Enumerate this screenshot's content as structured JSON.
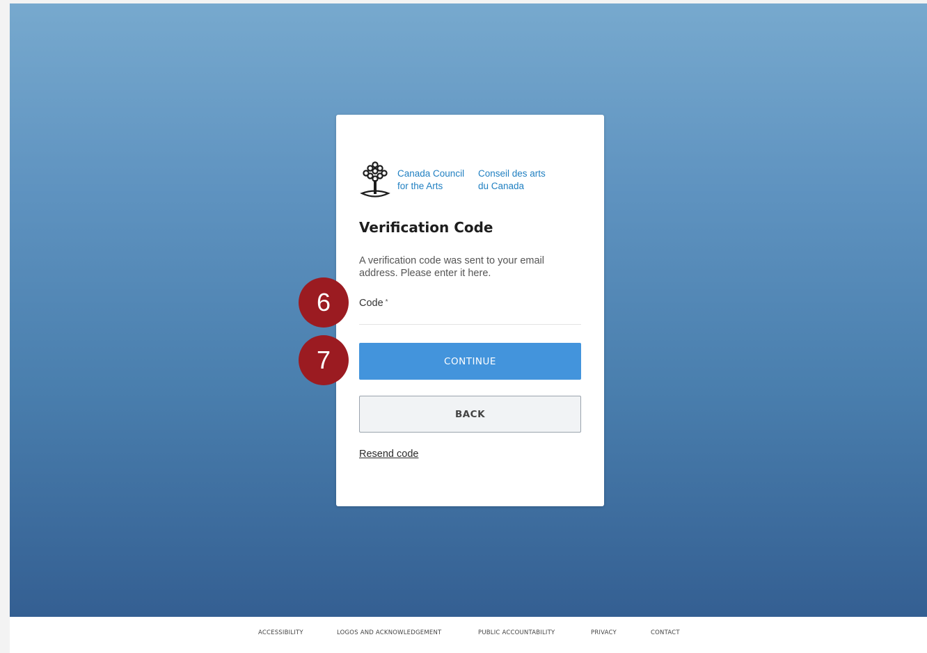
{
  "logo": {
    "en_line1": "Canada Council",
    "en_line2": "for the Arts",
    "fr_line1": "Conseil des arts",
    "fr_line2": "du Canada"
  },
  "card": {
    "title": "Verification Code",
    "description": "A verification code was sent to your email address. Please enter it here.",
    "code_label": "Code",
    "required_mark": "*",
    "code_value": "",
    "continue_label": "CONTINUE",
    "back_label": "BACK",
    "resend_label": "Resend code"
  },
  "markers": {
    "step6": "6",
    "step7": "7"
  },
  "footer": {
    "links": [
      "ACCESSIBILITY",
      "LOGOS AND ACKNOWLEDGEMENT",
      "PUBLIC ACCOUNTABILITY",
      "PRIVACY",
      "CONTACT"
    ]
  },
  "colors": {
    "primary_button": "#4394dc",
    "brand_blue": "#1f7fc1",
    "marker_red": "#9b1b21"
  }
}
